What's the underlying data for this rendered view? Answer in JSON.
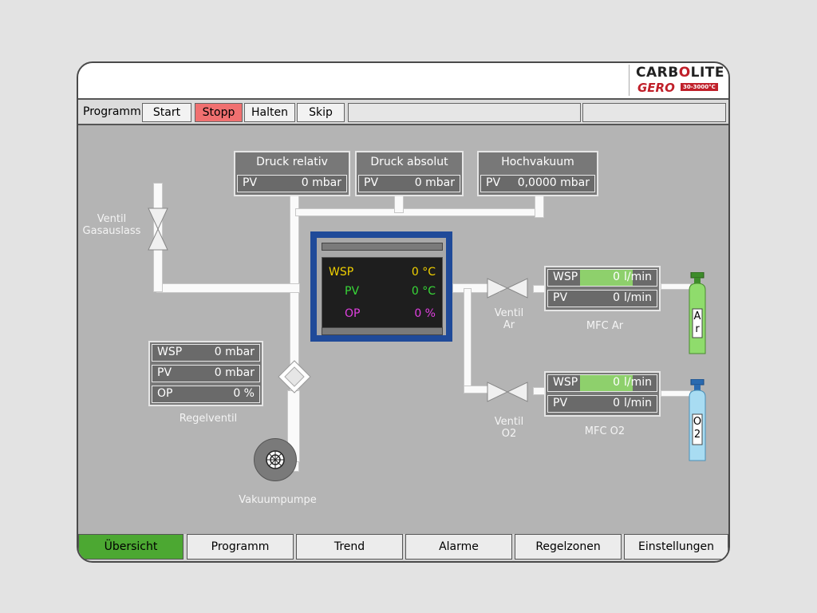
{
  "logo": {
    "line1_a": "CARB",
    "line1_o": "O",
    "line1_b": "LITE",
    "line2": "GERO",
    "badge": "30-3000°C"
  },
  "toolbar": {
    "label": "Programm",
    "start": "Start",
    "stopp": "Stopp",
    "halten": "Halten",
    "skip": "Skip"
  },
  "druck_relativ": {
    "title": "Druck relativ",
    "pv_label": "PV",
    "pv_value": "0 mbar"
  },
  "druck_absolut": {
    "title": "Druck absolut",
    "pv_label": "PV",
    "pv_value": "0 mbar"
  },
  "hochvakuum": {
    "title": "Hochvakuum",
    "pv_label": "PV",
    "pv_value": "0,0000 mbar"
  },
  "ventil_gasauslass": {
    "line1": "Ventil",
    "line2": "Gasauslass"
  },
  "furnace": {
    "wsp_label": "WSP",
    "wsp_value": "0 °C",
    "pv_label": "PV",
    "pv_value": "0 °C",
    "op_label": "OP",
    "op_value": "0 %"
  },
  "regelventil": {
    "wsp_label": "WSP",
    "wsp_value": "0 mbar",
    "pv_label": "PV",
    "pv_value": "0 mbar",
    "op_label": "OP",
    "op_value": "0 %",
    "caption": "Regelventil"
  },
  "mfc_ar": {
    "wsp_label": "WSP",
    "wsp_value": "0",
    "pv_label": "PV",
    "pv_value": "0",
    "unit": "l/min",
    "caption": "MFC Ar"
  },
  "mfc_o2": {
    "wsp_label": "WSP",
    "wsp_value": "0",
    "pv_label": "PV",
    "pv_value": "0",
    "unit": "l/min",
    "caption": "MFC O2"
  },
  "ventil_ar": {
    "line1": "Ventil",
    "line2": "Ar"
  },
  "ventil_o2": {
    "line1": "Ventil",
    "line2": "O2"
  },
  "bottle_ar": {
    "l1": "A",
    "l2": "r"
  },
  "bottle_o2": {
    "l1": "O",
    "l2": "2"
  },
  "vakuumpumpe": {
    "caption": "Vakuumpumpe"
  },
  "nav": [
    "Übersicht",
    "Programm",
    "Trend",
    "Alarme",
    "Regelzonen",
    "Einstellungen"
  ],
  "colors": {
    "wsp": "#f0d000",
    "pv": "#38d838",
    "op": "#e040e0",
    "active_tab": "#4ca832",
    "stopp": "#f07070",
    "furnace_frame": "#1f4a99"
  }
}
